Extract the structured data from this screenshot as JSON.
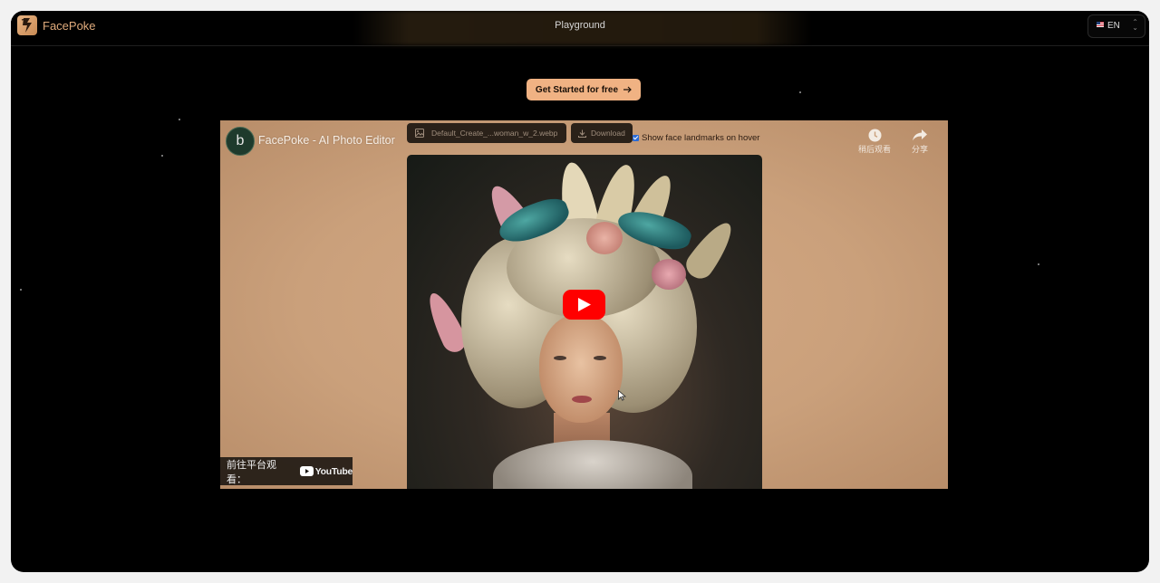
{
  "header": {
    "brand": "FacePoke",
    "nav_center": "Playground",
    "language": {
      "code": "EN",
      "flag": "us-flag-icon"
    }
  },
  "hero": {
    "cta_label": "Get Started for free",
    "cta_icon": "arrow-right-icon"
  },
  "video": {
    "channel_avatar_letter": "b",
    "title": "FacePoke - AI Photo Editor",
    "file_name": "Default_Create_...woman_w_2.webp",
    "download_label": "Download",
    "landmarks_label": "Show face landmarks on hover",
    "landmarks_checked": true,
    "watch_later_label": "稍后观看",
    "share_label": "分享",
    "watch_on_label": "前往平台观看：",
    "youtube_wordmark": "YouTube",
    "play_icon": "play-icon"
  },
  "colors": {
    "accent": "#f0b283",
    "brand_text": "#e0ab7c",
    "background": "#000000",
    "youtube_red": "#ff0000"
  }
}
